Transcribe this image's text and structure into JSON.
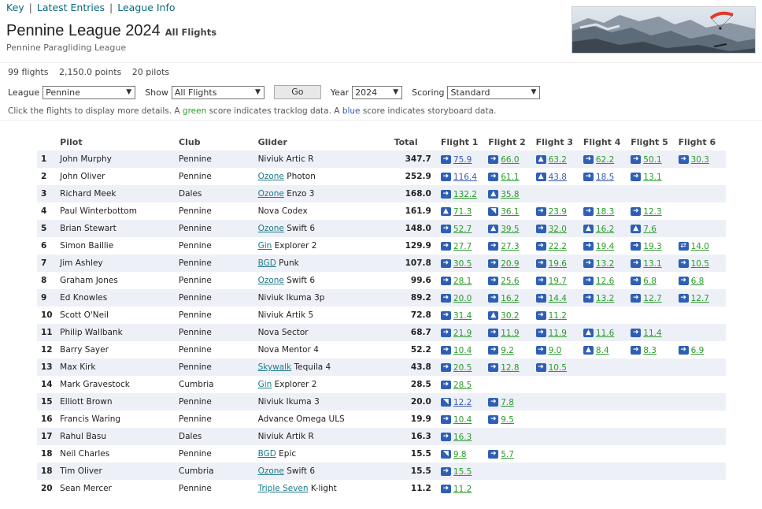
{
  "nav": {
    "key": "Key",
    "latest": "Latest Entries",
    "league_info": "League Info"
  },
  "header": {
    "title": "Pennine League 2024",
    "title_tag": "All Flights",
    "subtitle": "Pennine Paragliding League"
  },
  "stats": {
    "flights": "99 flights",
    "points": "2,150.0 points",
    "pilots": "20 pilots"
  },
  "controls": {
    "league_label": "League",
    "league_value": "Pennine",
    "show_label": "Show",
    "show_value": "All Flights",
    "go_label": "Go",
    "year_label": "Year",
    "year_value": "2024",
    "scoring_label": "Scoring",
    "scoring_value": "Standard"
  },
  "note": {
    "part1": "Click the flights to display more details. A ",
    "green_word": "green",
    "part2": " score indicates tracklog data. A ",
    "blue_word": "blue",
    "part3": " score indicates storyboard data."
  },
  "colors": {
    "green": "#2b9a2b",
    "blue": "#3a5ab0",
    "icon": "#2f5fb5",
    "row_alt": "#eef0f7"
  },
  "table": {
    "headers": [
      "Pilot",
      "Club",
      "Glider",
      "Total",
      "Flight 1",
      "Flight 2",
      "Flight 3",
      "Flight 4",
      "Flight 5",
      "Flight 6"
    ],
    "rows": [
      {
        "pos": "1",
        "pilot": "John Murphy",
        "club": "Pennine",
        "mfr": "",
        "model": "Niviuk Artic R",
        "total": "347.7",
        "flights": [
          {
            "icon": "right",
            "score": "75.9",
            "c": "blue"
          },
          {
            "icon": "right",
            "score": "66.0",
            "c": "green"
          },
          {
            "icon": "up",
            "score": "63.2",
            "c": "green"
          },
          {
            "icon": "right",
            "score": "62.2",
            "c": "green"
          },
          {
            "icon": "right",
            "score": "50.1",
            "c": "green"
          },
          {
            "icon": "right",
            "score": "30.3",
            "c": "green"
          }
        ]
      },
      {
        "pos": "2",
        "pilot": "John Oliver",
        "club": "Pennine",
        "mfr": "Ozone",
        "model": "Photon",
        "total": "252.9",
        "flights": [
          {
            "icon": "right",
            "score": "116.4",
            "c": "blue"
          },
          {
            "icon": "right",
            "score": "61.1",
            "c": "green"
          },
          {
            "icon": "up",
            "score": "43.8",
            "c": "blue"
          },
          {
            "icon": "right",
            "score": "18.5",
            "c": "blue"
          },
          {
            "icon": "right",
            "score": "13.1",
            "c": "green"
          }
        ]
      },
      {
        "pos": "3",
        "pilot": "Richard Meek",
        "club": "Dales",
        "mfr": "Ozone",
        "model": "Enzo 3",
        "total": "168.0",
        "flights": [
          {
            "icon": "right",
            "score": "132.2",
            "c": "green"
          },
          {
            "icon": "up",
            "score": "35.8",
            "c": "green"
          }
        ]
      },
      {
        "pos": "4",
        "pilot": "Paul Winterbottom",
        "club": "Pennine",
        "mfr": "",
        "model": "Nova Codex",
        "total": "161.9",
        "flights": [
          {
            "icon": "up",
            "score": "71.3",
            "c": "green"
          },
          {
            "icon": "diag",
            "score": "36.1",
            "c": "green"
          },
          {
            "icon": "right",
            "score": "23.9",
            "c": "green"
          },
          {
            "icon": "right",
            "score": "18.3",
            "c": "green"
          },
          {
            "icon": "right",
            "score": "12.3",
            "c": "green"
          }
        ]
      },
      {
        "pos": "5",
        "pilot": "Brian Stewart",
        "club": "Pennine",
        "mfr": "Ozone",
        "model": "Swift 6",
        "total": "148.0",
        "flights": [
          {
            "icon": "right",
            "score": "52.7",
            "c": "green"
          },
          {
            "icon": "up",
            "score": "39.5",
            "c": "green"
          },
          {
            "icon": "right",
            "score": "32.0",
            "c": "green"
          },
          {
            "icon": "up",
            "score": "16.2",
            "c": "green"
          },
          {
            "icon": "up",
            "score": "7.6",
            "c": "green"
          }
        ]
      },
      {
        "pos": "6",
        "pilot": "Simon Baillie",
        "club": "Pennine",
        "mfr": "Gin",
        "model": "Explorer 2",
        "total": "129.9",
        "flights": [
          {
            "icon": "right",
            "score": "27.7",
            "c": "green"
          },
          {
            "icon": "right",
            "score": "27.3",
            "c": "green"
          },
          {
            "icon": "right",
            "score": "22.2",
            "c": "green"
          },
          {
            "icon": "right",
            "score": "19.4",
            "c": "green"
          },
          {
            "icon": "right",
            "score": "19.3",
            "c": "green"
          },
          {
            "icon": "both",
            "score": "14.0",
            "c": "green"
          }
        ]
      },
      {
        "pos": "7",
        "pilot": "Jim Ashley",
        "club": "Pennine",
        "mfr": "BGD",
        "model": "Punk",
        "total": "107.8",
        "flights": [
          {
            "icon": "right",
            "score": "30.5",
            "c": "green"
          },
          {
            "icon": "right",
            "score": "20.9",
            "c": "green"
          },
          {
            "icon": "right",
            "score": "19.6",
            "c": "green"
          },
          {
            "icon": "right",
            "score": "13.2",
            "c": "green"
          },
          {
            "icon": "right",
            "score": "13.1",
            "c": "green"
          },
          {
            "icon": "right",
            "score": "10.5",
            "c": "green"
          }
        ]
      },
      {
        "pos": "8",
        "pilot": "Graham Jones",
        "club": "Pennine",
        "mfr": "Ozone",
        "model": "Swift 6",
        "total": "99.6",
        "flights": [
          {
            "icon": "right",
            "score": "28.1",
            "c": "green"
          },
          {
            "icon": "right",
            "score": "25.6",
            "c": "green"
          },
          {
            "icon": "right",
            "score": "19.7",
            "c": "green"
          },
          {
            "icon": "right",
            "score": "12.6",
            "c": "green"
          },
          {
            "icon": "right",
            "score": "6.8",
            "c": "green"
          },
          {
            "icon": "right",
            "score": "6.8",
            "c": "green"
          }
        ]
      },
      {
        "pos": "9",
        "pilot": "Ed Knowles",
        "club": "Pennine",
        "mfr": "",
        "model": "Niviuk Ikuma 3p",
        "total": "89.2",
        "flights": [
          {
            "icon": "right",
            "score": "20.0",
            "c": "green"
          },
          {
            "icon": "right",
            "score": "16.2",
            "c": "green"
          },
          {
            "icon": "right",
            "score": "14.4",
            "c": "green"
          },
          {
            "icon": "right",
            "score": "13.2",
            "c": "green"
          },
          {
            "icon": "right",
            "score": "12.7",
            "c": "green"
          },
          {
            "icon": "right",
            "score": "12.7",
            "c": "green"
          }
        ]
      },
      {
        "pos": "10",
        "pilot": "Scott O'Neil",
        "club": "Pennine",
        "mfr": "",
        "model": "Niviuk Artik 5",
        "total": "72.8",
        "flights": [
          {
            "icon": "right",
            "score": "31.4",
            "c": "green"
          },
          {
            "icon": "up",
            "score": "30.2",
            "c": "green"
          },
          {
            "icon": "right",
            "score": "11.2",
            "c": "green"
          }
        ]
      },
      {
        "pos": "11",
        "pilot": "Philip Wallbank",
        "club": "Pennine",
        "mfr": "",
        "model": "Nova Sector",
        "total": "68.7",
        "flights": [
          {
            "icon": "right",
            "score": "21.9",
            "c": "green"
          },
          {
            "icon": "right",
            "score": "11.9",
            "c": "green"
          },
          {
            "icon": "right",
            "score": "11.9",
            "c": "green"
          },
          {
            "icon": "up",
            "score": "11.6",
            "c": "green"
          },
          {
            "icon": "right",
            "score": "11.4",
            "c": "green"
          }
        ]
      },
      {
        "pos": "12",
        "pilot": "Barry Sayer",
        "club": "Pennine",
        "mfr": "",
        "model": "Nova Mentor 4",
        "total": "52.2",
        "flights": [
          {
            "icon": "right",
            "score": "10.4",
            "c": "green"
          },
          {
            "icon": "right",
            "score": "9.2",
            "c": "green"
          },
          {
            "icon": "right",
            "score": "9.0",
            "c": "green"
          },
          {
            "icon": "up",
            "score": "8.4",
            "c": "green"
          },
          {
            "icon": "right",
            "score": "8.3",
            "c": "green"
          },
          {
            "icon": "right",
            "score": "6.9",
            "c": "green"
          }
        ]
      },
      {
        "pos": "13",
        "pilot": "Max Kirk",
        "club": "Pennine",
        "mfr": "Skywalk",
        "model": "Tequila 4",
        "total": "43.8",
        "flights": [
          {
            "icon": "right",
            "score": "20.5",
            "c": "green"
          },
          {
            "icon": "right",
            "score": "12.8",
            "c": "green"
          },
          {
            "icon": "right",
            "score": "10.5",
            "c": "green"
          }
        ]
      },
      {
        "pos": "14",
        "pilot": "Mark Gravestock",
        "club": "Cumbria",
        "mfr": "Gin",
        "model": "Explorer 2",
        "total": "28.5",
        "flights": [
          {
            "icon": "right",
            "score": "28.5",
            "c": "green"
          }
        ]
      },
      {
        "pos": "15",
        "pilot": "Elliott Brown",
        "club": "Pennine",
        "mfr": "",
        "model": "Niviuk Ikuma 3",
        "total": "20.0",
        "flights": [
          {
            "icon": "diag",
            "score": "12.2",
            "c": "blue"
          },
          {
            "icon": "right",
            "score": "7.8",
            "c": "green"
          }
        ]
      },
      {
        "pos": "16",
        "pilot": "Francis Waring",
        "club": "Pennine",
        "mfr": "",
        "model": "Advance Omega ULS",
        "total": "19.9",
        "flights": [
          {
            "icon": "right",
            "score": "10.4",
            "c": "green"
          },
          {
            "icon": "right",
            "score": "9.5",
            "c": "green"
          }
        ]
      },
      {
        "pos": "17",
        "pilot": "Rahul Basu",
        "club": "Dales",
        "mfr": "",
        "model": "Niviuk Artik R",
        "total": "16.3",
        "flights": [
          {
            "icon": "right",
            "score": "16.3",
            "c": "green"
          }
        ]
      },
      {
        "pos": "18",
        "pilot": "Neil Charles",
        "club": "Pennine",
        "mfr": "BGD",
        "model": "Epic",
        "total": "15.5",
        "flights": [
          {
            "icon": "diag",
            "score": "9.8",
            "c": "green"
          },
          {
            "icon": "right",
            "score": "5.7",
            "c": "green"
          }
        ]
      },
      {
        "pos": "18",
        "pilot": "Tim Oliver",
        "club": "Cumbria",
        "mfr": "Ozone",
        "model": "Swift 6",
        "total": "15.5",
        "flights": [
          {
            "icon": "right",
            "score": "15.5",
            "c": "green"
          }
        ]
      },
      {
        "pos": "20",
        "pilot": "Sean Mercer",
        "club": "Pennine",
        "mfr": "Triple Seven",
        "model": "K-light",
        "total": "11.2",
        "flights": [
          {
            "icon": "right",
            "score": "11.2",
            "c": "green"
          }
        ]
      }
    ]
  }
}
